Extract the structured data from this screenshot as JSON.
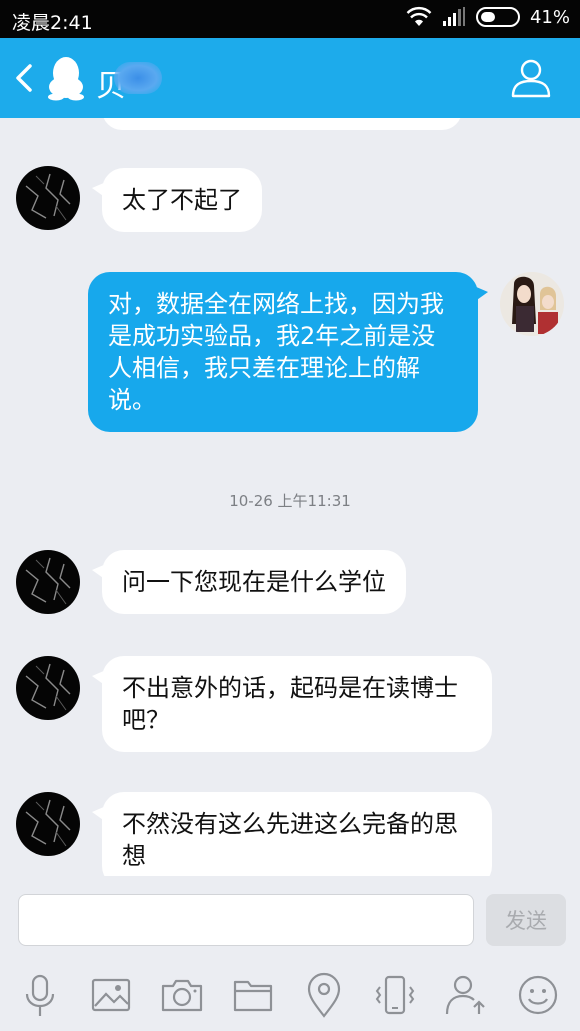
{
  "status_bar": {
    "time": "凌晨2:41",
    "battery": "41%",
    "battery_level": 0.41
  },
  "header": {
    "title": "贝"
  },
  "messages": [
    {
      "side": "left",
      "text": "太了不起了"
    },
    {
      "side": "right",
      "text": "对，数据全在网络上找，因为我是成功实验品，我2年之前是没人相信，我只差在理论上的解说。"
    },
    {
      "type": "timestamp",
      "text": "10-26 上午11:31"
    },
    {
      "side": "left",
      "text": "问一下您现在是什么学位"
    },
    {
      "side": "left",
      "text": "不出意外的话，起码是在读博士吧？"
    },
    {
      "side": "left",
      "text": "不然没有这么先进这么完备的思想"
    }
  ],
  "input": {
    "value": "",
    "placeholder": ""
  },
  "send_button": {
    "label": "发送"
  },
  "toolbar": {
    "icons": [
      "microphone-icon",
      "image-icon",
      "camera-icon",
      "folder-icon",
      "location-icon",
      "shake-phone-icon",
      "share-contact-icon",
      "emoji-icon"
    ]
  },
  "colors": {
    "accent": "#1dabeb",
    "bubble_self": "#17a8ec",
    "background": "#ebedf2"
  }
}
